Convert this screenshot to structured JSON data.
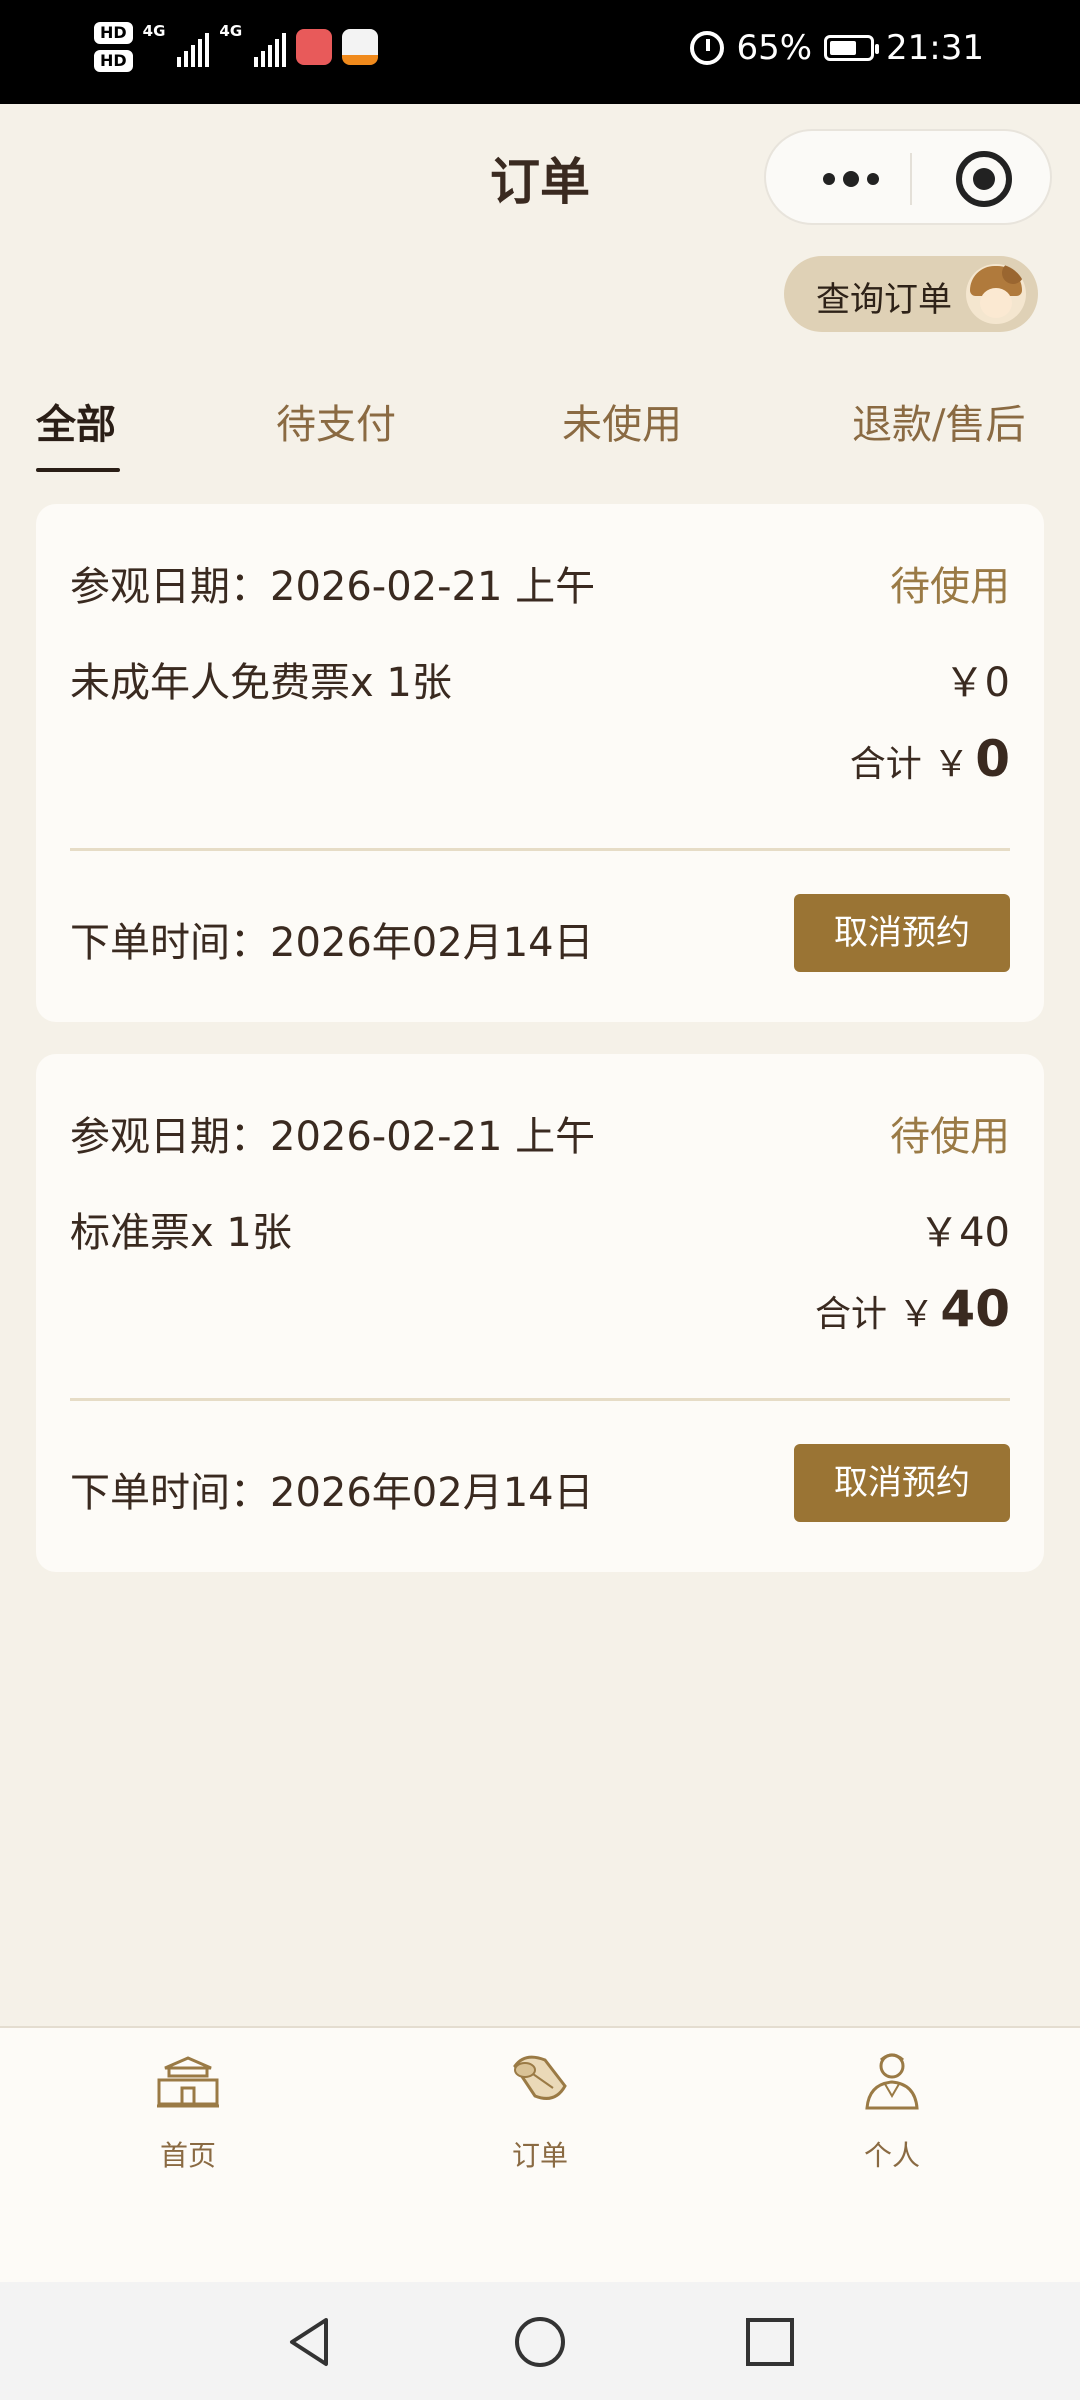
{
  "status_bar": {
    "battery": "65%",
    "time": "21:31",
    "sig1": "4G",
    "sig2": "4G",
    "hd1": "HD",
    "hd2": "HD"
  },
  "header": {
    "title": "订单",
    "more_icon": "more-dots-icon",
    "close_icon": "target-circle-icon"
  },
  "query_button": {
    "label": "查询订单",
    "icon": "avatar-icon"
  },
  "tabs": [
    {
      "label": "全部",
      "active": true
    },
    {
      "label": "待支付",
      "active": false
    },
    {
      "label": "未使用",
      "active": false
    },
    {
      "label": "退款/售后",
      "active": false
    }
  ],
  "orders": [
    {
      "visit_date": "参观日期：2026-02-21 上午",
      "status": "待使用",
      "ticket": "未成年人免费票x 1张",
      "price": "￥0",
      "total_label": "合计 ￥",
      "total_value": "0",
      "order_time": "下单时间：2026年02月14日",
      "cancel_label": "取消预约"
    },
    {
      "visit_date": "参观日期：2026-02-21 上午",
      "status": "待使用",
      "ticket": "标准票x 1张",
      "price": "￥40",
      "total_label": "合计 ￥",
      "total_value": "40",
      "order_time": "下单时间：2026年02月14日",
      "cancel_label": "取消预约"
    }
  ],
  "bottom_nav": [
    {
      "label": "首页",
      "icon": "palace-home-icon"
    },
    {
      "label": "订单",
      "icon": "scroll-order-icon"
    },
    {
      "label": "个人",
      "icon": "person-icon"
    }
  ],
  "colors": {
    "background": "#f5f1e8",
    "accent": "#9a7434",
    "status": "#9a7a45",
    "text": "#3a2a20"
  }
}
